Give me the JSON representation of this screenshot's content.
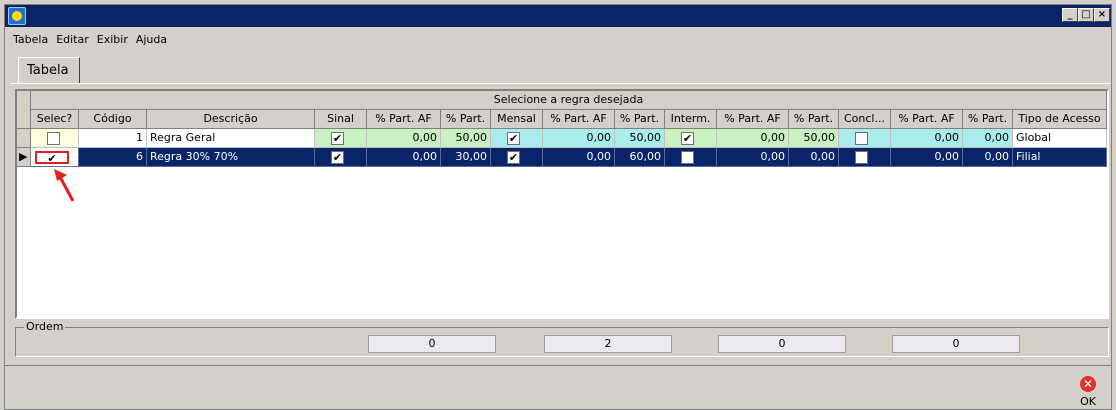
{
  "menus": [
    "Tabela",
    "Editar",
    "Exibir",
    "Ajuda"
  ],
  "tab_label": "Tabela",
  "grid_title": "Selecione a regra desejada",
  "columns": [
    "Selec?",
    "Código",
    "Descrição",
    "Sinal",
    "% Part. AF",
    "% Part.",
    "Mensal",
    "% Part. AF",
    "% Part.",
    "Interm.",
    "% Part. AF",
    "% Part.",
    "Concl...",
    "% Part. AF",
    "% Part.",
    "Tipo de Acesso"
  ],
  "rows": [
    {
      "selec": false,
      "codigo": "1",
      "descricao": "Regra Geral",
      "sinal": true,
      "sinal_af": "0,00",
      "sinal_part": "50,00",
      "mensal": true,
      "mensal_af": "0,00",
      "mensal_part": "50,00",
      "interm": true,
      "interm_af": "0,00",
      "interm_part": "50,00",
      "concl": false,
      "concl_af": "0,00",
      "concl_part": "0,00",
      "tipo": "Global"
    },
    {
      "selec": true,
      "codigo": "6",
      "descricao": "Regra 30% 70%",
      "sinal": true,
      "sinal_af": "0,00",
      "sinal_part": "30,00",
      "mensal": true,
      "mensal_af": "0,00",
      "mensal_part": "60,00",
      "interm": false,
      "interm_af": "0,00",
      "interm_part": "0,00",
      "concl": false,
      "concl_af": "0,00",
      "concl_part": "0,00",
      "tipo": "Filial"
    }
  ],
  "ordem_label": "Ordem",
  "ordem_values": [
    "0",
    "2",
    "0",
    "0"
  ],
  "ok_label": "OK",
  "ok_icon": "cancel-x-icon",
  "colors": {
    "title_bar": "#0a246a",
    "selected_row": "#0a246a",
    "green_cells": "#c8f0c0",
    "cyan_cells": "#a8ecec",
    "arrow": "#e02020"
  }
}
